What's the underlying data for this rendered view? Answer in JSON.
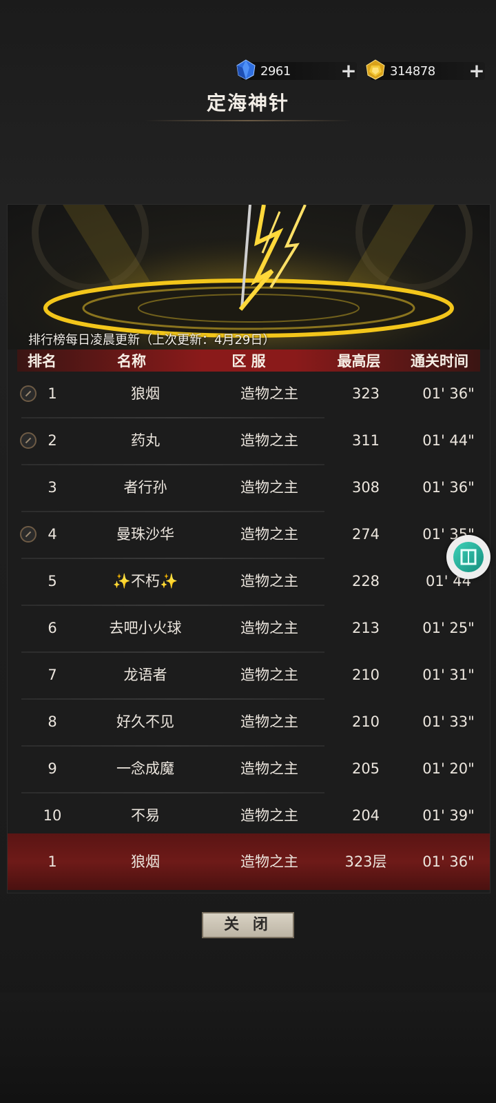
{
  "currency": {
    "blue": {
      "amount": "2961",
      "icon": "blue-gem-icon"
    },
    "gold": {
      "amount": "314878",
      "icon": "gold-gem-icon"
    }
  },
  "title": "定海神针",
  "update_note": "排行榜每日凌晨更新（上次更新：4月29日）",
  "headers": {
    "rank": "排名",
    "name": "名称",
    "server": "区 服",
    "level": "最高层",
    "time": "通关时间"
  },
  "rows": [
    {
      "rank": "1",
      "name": "狼烟",
      "server": "造物之主",
      "level": "323",
      "time": "01' 36\""
    },
    {
      "rank": "2",
      "name": "药丸",
      "server": "造物之主",
      "level": "311",
      "time": "01' 44\""
    },
    {
      "rank": "3",
      "name": "者行孙",
      "server": "造物之主",
      "level": "308",
      "time": "01' 36\""
    },
    {
      "rank": "4",
      "name": "曼珠沙华",
      "server": "造物之主",
      "level": "274",
      "time": "01' 35\""
    },
    {
      "rank": "5",
      "name": "✨不朽✨",
      "server": "造物之主",
      "level": "228",
      "time": "01' 44"
    },
    {
      "rank": "6",
      "name": "去吧小火球",
      "server": "造物之主",
      "level": "213",
      "time": "01' 25\""
    },
    {
      "rank": "7",
      "name": "龙语者",
      "server": "造物之主",
      "level": "210",
      "time": "01' 31\""
    },
    {
      "rank": "8",
      "name": "好久不见",
      "server": "造物之主",
      "level": "210",
      "time": "01' 33\""
    },
    {
      "rank": "9",
      "name": "一念成魔",
      "server": "造物之主",
      "level": "205",
      "time": "01' 20\""
    },
    {
      "rank": "10",
      "name": "不易",
      "server": "造物之主",
      "level": "204",
      "time": "01' 39\""
    }
  ],
  "my_rank": {
    "rank": "1",
    "name": "狼烟",
    "server": "造物之主",
    "level": "323层",
    "time": "01' 36\""
  },
  "close_label": "关 闭",
  "colors": {
    "header_red": "#8a1a1a",
    "my_row_red": "#6e1a18",
    "lightning_gold": "#f3c61b"
  }
}
